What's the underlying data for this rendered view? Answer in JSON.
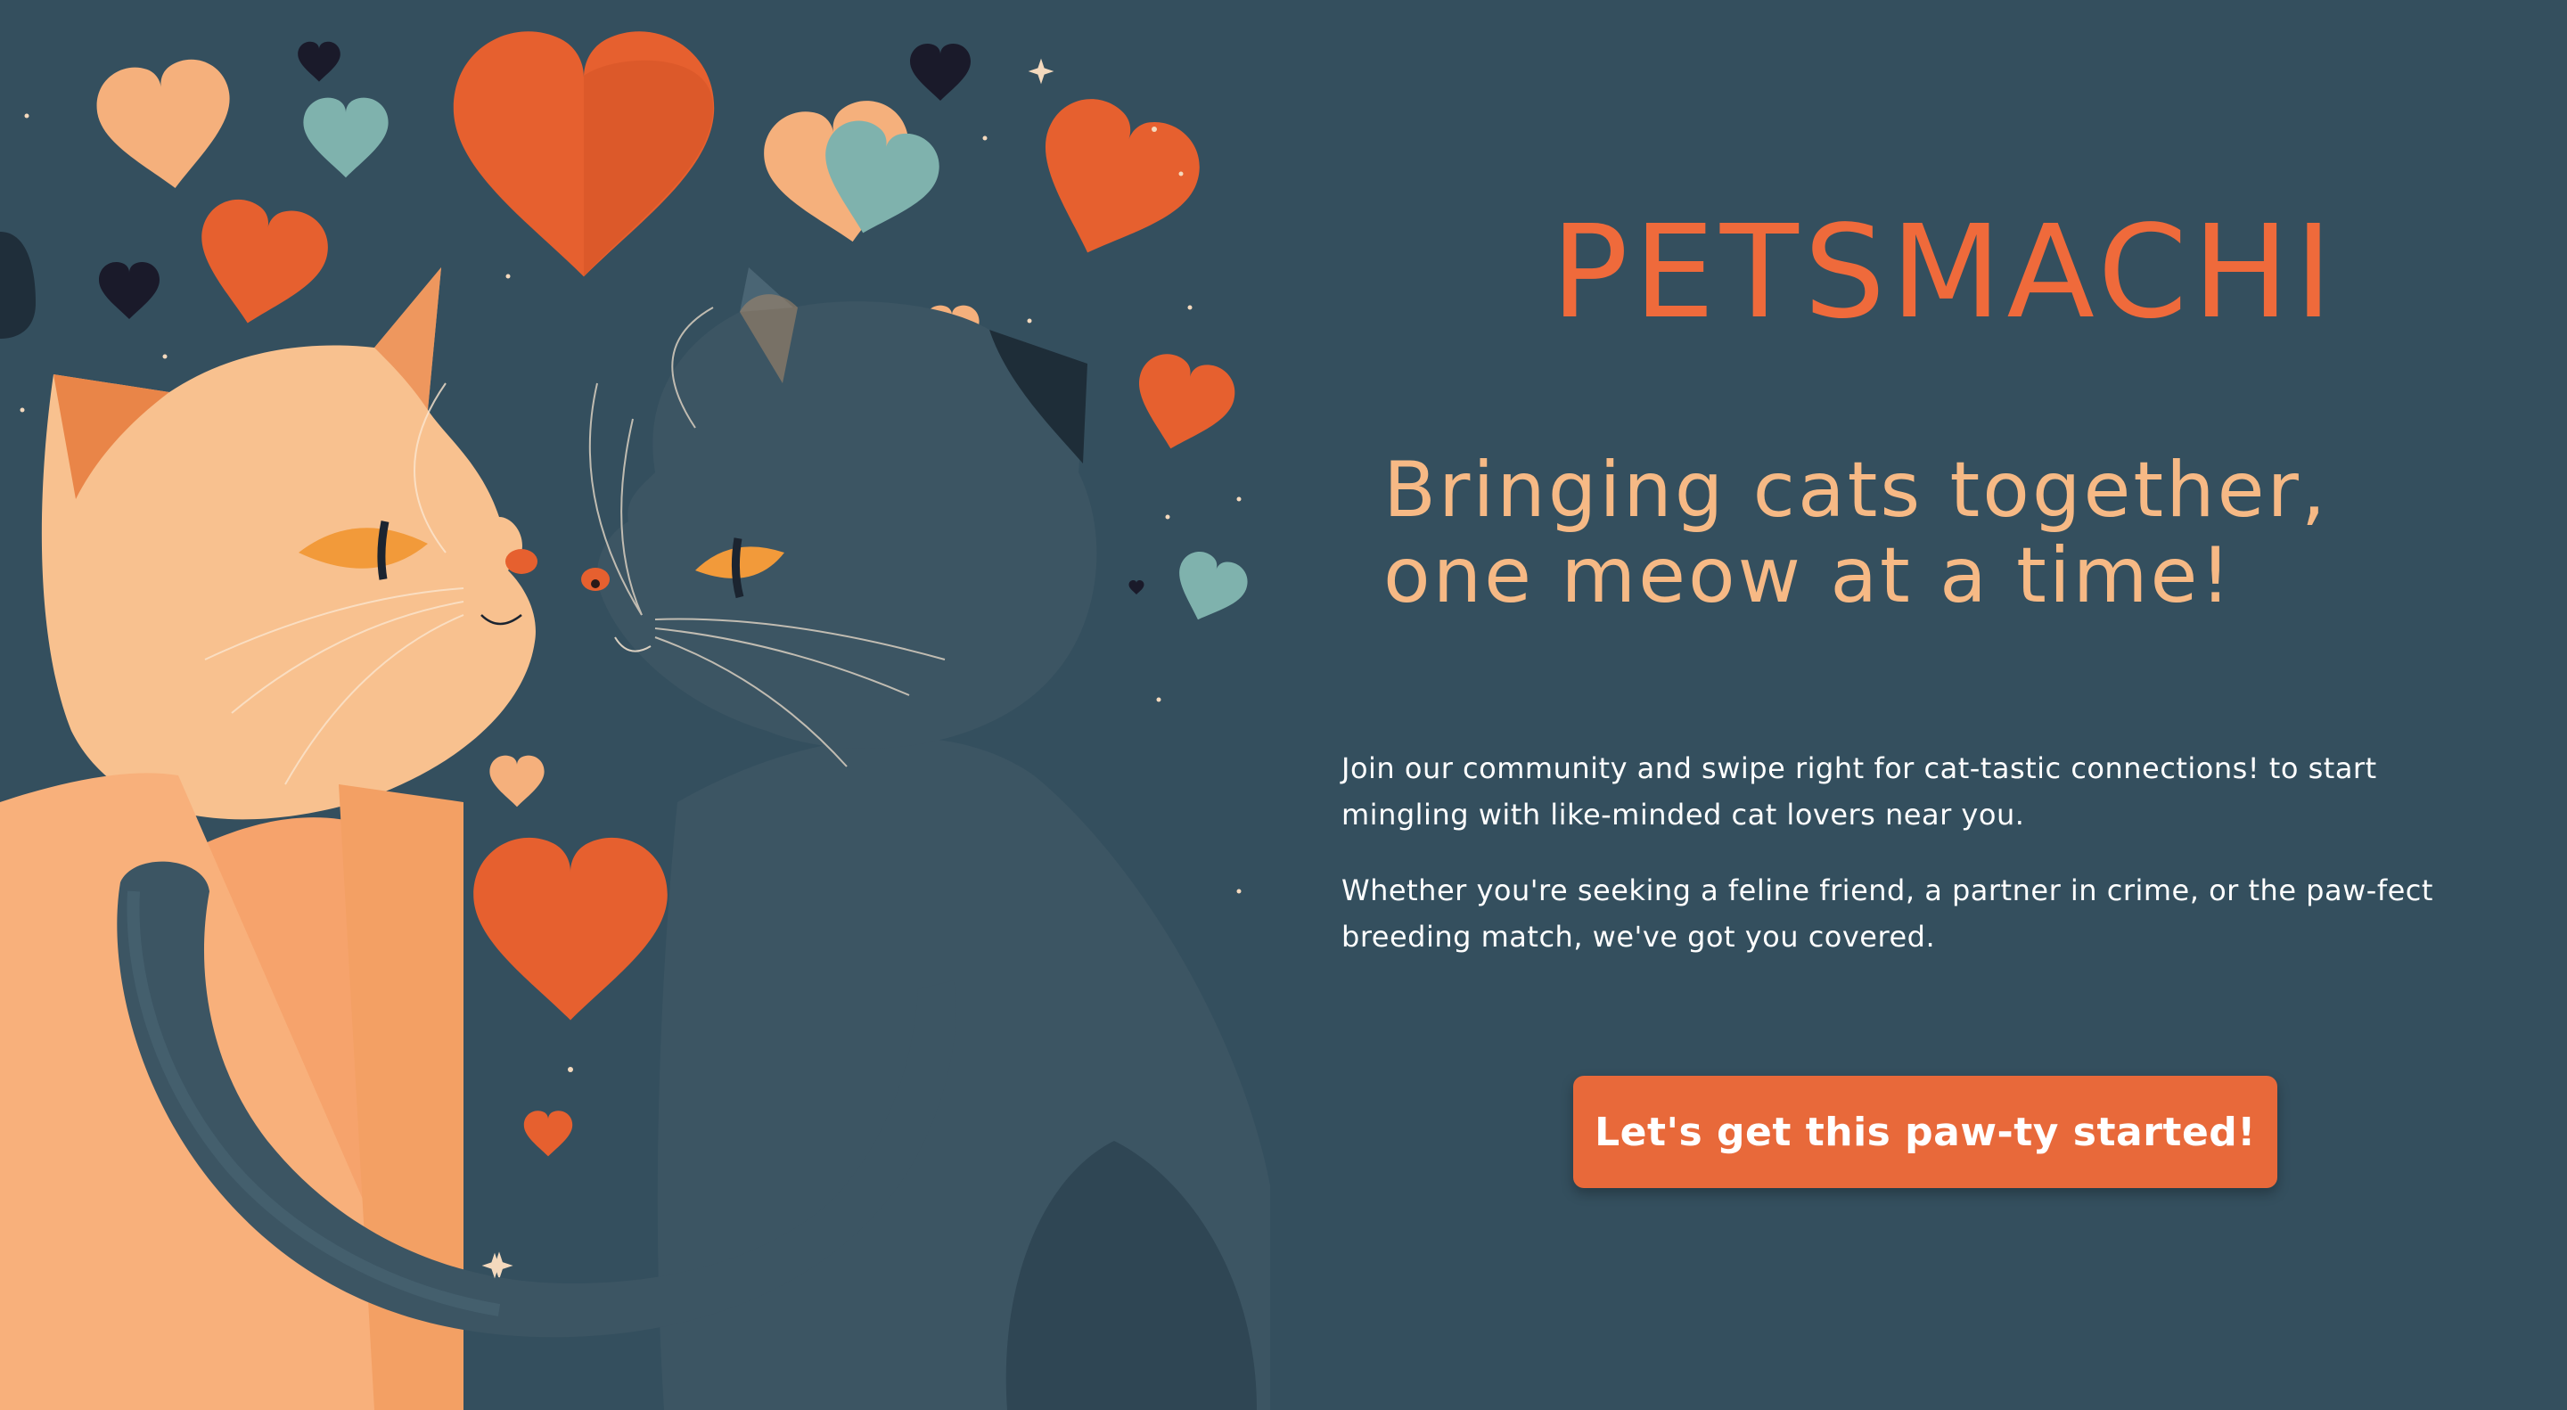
{
  "brand": {
    "name": "PETSMACHI"
  },
  "hero": {
    "tagline_line1": "Bringing cats together,",
    "tagline_line2": "one meow at a time!",
    "paragraph1": "Join our community and swipe right for cat-tastic connections! to start mingling with like-minded cat lovers near you.",
    "paragraph2": "Whether you're seeking a feline friend, a partner in crime, or the paw-fect breeding match, we've got you covered.",
    "cta_label": "Let's get this paw-ty started!"
  },
  "colors": {
    "background": "#344f5e",
    "accent": "#ef6a3b",
    "tagline": "#f6b985",
    "button": "#e8693a",
    "text": "#ffffff"
  },
  "illustration": {
    "subject": "two-cats-with-hearts",
    "cats": [
      "orange-cat",
      "dark-gray-cat"
    ],
    "decorations": [
      "hearts",
      "sparkles"
    ]
  }
}
